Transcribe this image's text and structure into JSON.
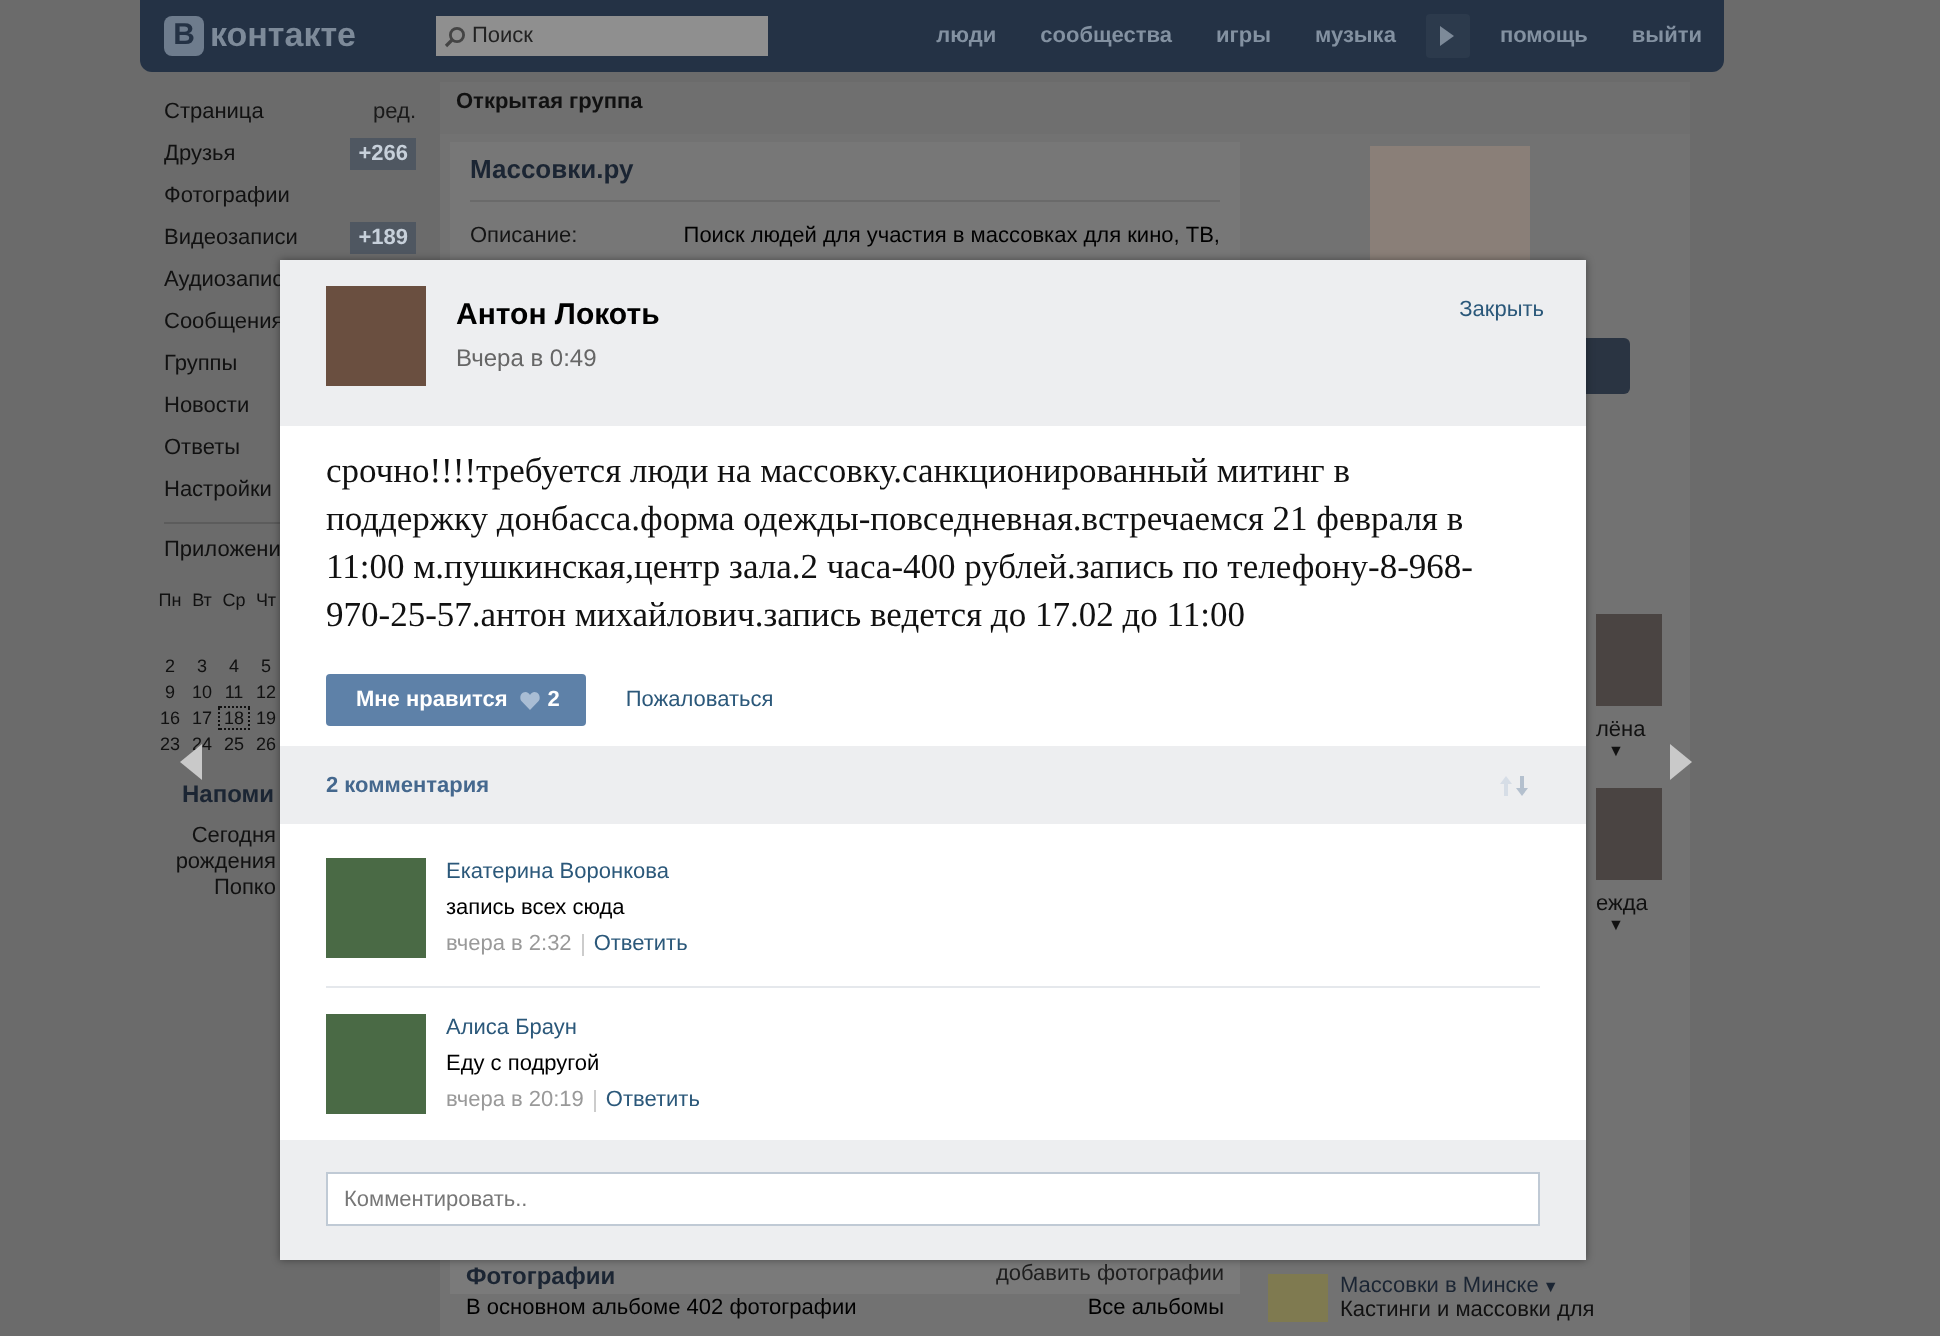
{
  "header": {
    "logo": {
      "letter": "В",
      "text": "контакте"
    },
    "search": {
      "placeholder": "Поиск"
    },
    "nav": [
      "люди",
      "сообщества",
      "игры",
      "музыка",
      "помощь",
      "выйти"
    ]
  },
  "sidebar": {
    "items": [
      {
        "label": "Страница",
        "kind": "edit",
        "badge": "ред."
      },
      {
        "label": "Друзья",
        "kind": "count",
        "badge": "+266"
      },
      {
        "label": "Фотографии",
        "kind": "plain"
      },
      {
        "label": "Видеозаписи",
        "kind": "count",
        "badge": "+189"
      },
      {
        "label": "Аудиозапис",
        "kind": "plain"
      },
      {
        "label": "Сообщения",
        "kind": "plain"
      },
      {
        "label": "Группы",
        "kind": "plain"
      },
      {
        "label": "Новости",
        "kind": "plain"
      },
      {
        "label": "Ответы",
        "kind": "plain"
      },
      {
        "label": "Настройки",
        "kind": "plain"
      }
    ],
    "apps": "Приложени",
    "calendar": {
      "weekdays": [
        "Пн",
        "Вт",
        "Ср",
        "Чт"
      ],
      "weeks": [
        [
          {
            "day": "2",
            "today": false
          },
          {
            "day": "3",
            "today": false
          },
          {
            "day": "4",
            "today": false
          },
          {
            "day": "5",
            "today": false
          }
        ],
        [
          {
            "day": "9",
            "today": false
          },
          {
            "day": "10",
            "today": false
          },
          {
            "day": "11",
            "today": false
          },
          {
            "day": "12",
            "today": false
          }
        ],
        [
          {
            "day": "16",
            "today": false
          },
          {
            "day": "17",
            "today": false
          },
          {
            "day": "18",
            "today": true
          },
          {
            "day": "19",
            "today": false
          }
        ],
        [
          {
            "day": "23",
            "today": false
          },
          {
            "day": "24",
            "today": false
          },
          {
            "day": "25",
            "today": false
          },
          {
            "day": "26",
            "today": false
          }
        ]
      ]
    },
    "reminder": {
      "title": "Напоми",
      "lines": [
        "Сегодня",
        "рождения",
        "Попко"
      ]
    }
  },
  "group": {
    "type": "Открытая группа",
    "name": "Массовки.ру",
    "description_label": "Описание:",
    "description": "Поиск людей для участия в массовках для кино, ТВ,",
    "photos_title": "Фотографии",
    "photos_action": "добавить фотографии",
    "album_info": "В основном альбоме 402 фотографии",
    "albums_link": "Все альбомы"
  },
  "right_column": {
    "friends": [
      {
        "name": "лёна",
        "caret": "▼"
      },
      {
        "name": "ежда",
        "caret": "▼"
      }
    ],
    "groups": [
      {
        "title": "Массовки в Минске",
        "caret": "▼",
        "desc": "Кастинги и массовки для"
      }
    ]
  },
  "modal": {
    "author": "Антон Локоть",
    "time": "Вчера в 0:49",
    "close": "Закрыть",
    "text": "срочно!!!!требуется люди на массовку.санкционированный митинг в поддержку донбасса.форма одежды-повседневная.встречаемся 21 февраля в 11:00 м.пушкинская,центр зала.2 часа-400 рублей.запись по телефону-8-968-970-25-57.антон михайлович.запись ведется до 17.02 до 11:00",
    "like": {
      "label": "Мне нравится",
      "count": "2",
      "liked": false
    },
    "report": "Пожаловаться",
    "comments_title": "2 комментария",
    "comments": [
      {
        "author": "Екатерина Воронкова",
        "text": "запись всех сюда",
        "time": "вчера в 2:32",
        "reply": "Ответить"
      },
      {
        "author": "Алиса Браун",
        "text": "Еду с подругой",
        "time": "вчера в 20:19",
        "reply": "Ответить"
      }
    ],
    "comment_field": {
      "placeholder": "Комментировать.."
    }
  }
}
